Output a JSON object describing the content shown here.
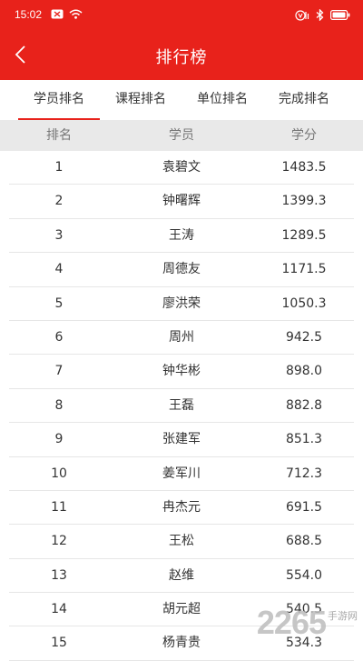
{
  "status_bar": {
    "time": "15:02",
    "icons": [
      "notification-icon",
      "wifi-icon",
      "hd-call-icon",
      "bluetooth-icon",
      "battery-icon"
    ]
  },
  "header": {
    "title": "排行榜",
    "back_icon": "chevron-left-icon",
    "background_color": "#e8221b"
  },
  "tabs": [
    {
      "label": "学员排名",
      "active": true
    },
    {
      "label": "课程排名",
      "active": false
    },
    {
      "label": "单位排名",
      "active": false
    },
    {
      "label": "完成排名",
      "active": false
    }
  ],
  "table": {
    "columns": [
      "排名",
      "学员",
      "学分"
    ],
    "rows": [
      {
        "rank": "1",
        "name": "袁碧文",
        "score": "1483.5"
      },
      {
        "rank": "2",
        "name": "钟曙辉",
        "score": "1399.3"
      },
      {
        "rank": "3",
        "name": "王涛",
        "score": "1289.5"
      },
      {
        "rank": "4",
        "name": "周德友",
        "score": "1171.5"
      },
      {
        "rank": "5",
        "name": "廖洪荣",
        "score": "1050.3"
      },
      {
        "rank": "6",
        "name": "周州",
        "score": "942.5"
      },
      {
        "rank": "7",
        "name": "钟华彬",
        "score": "898.0"
      },
      {
        "rank": "8",
        "name": "王磊",
        "score": "882.8"
      },
      {
        "rank": "9",
        "name": "张建军",
        "score": "851.3"
      },
      {
        "rank": "10",
        "name": "姜军川",
        "score": "712.3"
      },
      {
        "rank": "11",
        "name": "冉杰元",
        "score": "691.5"
      },
      {
        "rank": "12",
        "name": "王松",
        "score": "688.5"
      },
      {
        "rank": "13",
        "name": "赵维",
        "score": "554.0"
      },
      {
        "rank": "14",
        "name": "胡元超",
        "score": "540.5"
      },
      {
        "rank": "15",
        "name": "杨青贵",
        "score": "534.3"
      }
    ]
  },
  "watermark": {
    "number": "2265",
    "text": "手游网"
  }
}
